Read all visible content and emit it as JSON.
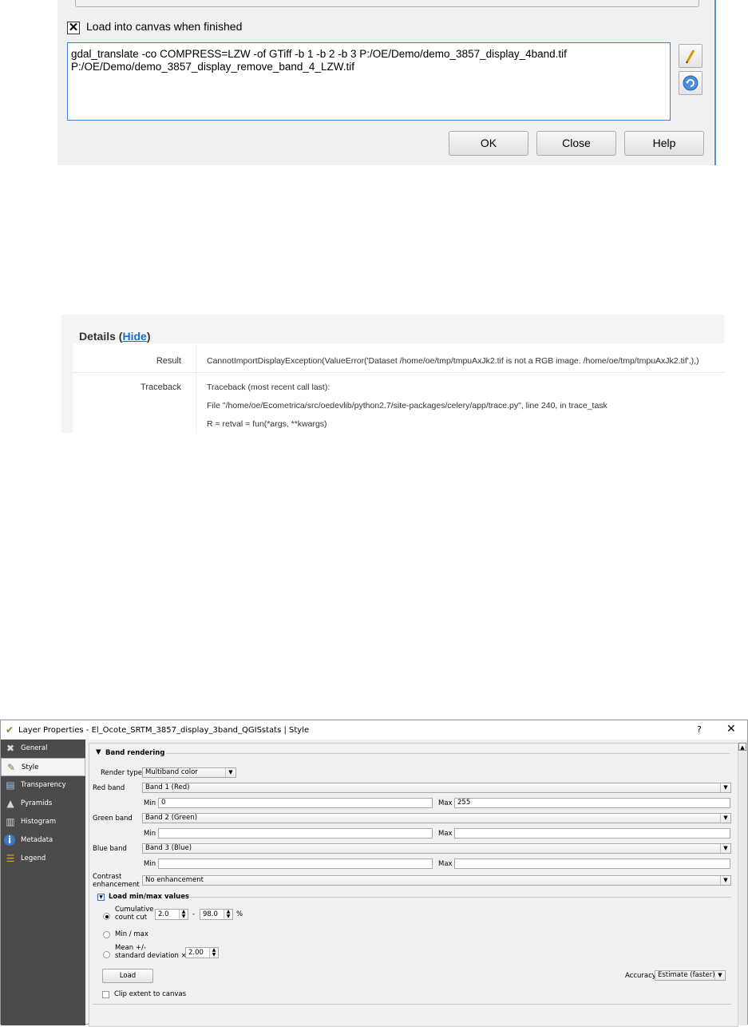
{
  "gdal_dialog": {
    "load_canvas_label": "Load into canvas when finished",
    "load_canvas_checked": true,
    "command_text": "gdal_translate -co COMPRESS=LZW -of GTiff -b 1 -b 2 -b 3 P:/OE/Demo/demo_3857_display_4band.tif\nP:/OE/Demo/demo_3857_display_remove_band_4_LZW.tif",
    "edit_icon": "pencil-icon",
    "reset_icon": "refresh-icon",
    "ok_label": "OK",
    "close_label": "Close",
    "help_label": "Help"
  },
  "details": {
    "title": "Details (",
    "hide_link": "Hide",
    "title_end": ")",
    "result_label": "Result",
    "result_value": "CannotImportDisplayException(ValueError('Dataset /home/oe/tmp/tmpuAxJk2.tif is not a RGB image. /home/oe/tmp/tmpuAxJk2.tif',),)",
    "traceback_label": "Traceback",
    "traceback_lines": [
      "Traceback (most recent call last):",
      "File \"/home/oe/Ecometrica/src/oedevlib/python2.7/site-packages/celery/app/trace.py\", line 240, in trace_task",
      "R = retval = fun(*args, **kwargs)"
    ]
  },
  "layer_props": {
    "title": "Layer Properties - El_Ocote_SRTM_3857_display_3band_QGISstats | Style",
    "help": "?",
    "close": "✕",
    "sidebar": [
      {
        "label": "General",
        "icon": "wrench-icon",
        "glyph": "✖"
      },
      {
        "label": "Style",
        "icon": "brush-icon",
        "glyph": "✎"
      },
      {
        "label": "Transparency",
        "icon": "transparency-icon",
        "glyph": "▤"
      },
      {
        "label": "Pyramids",
        "icon": "pyramids-icon",
        "glyph": "▲"
      },
      {
        "label": "Histogram",
        "icon": "histogram-icon",
        "glyph": "▥"
      },
      {
        "label": "Metadata",
        "icon": "info-icon",
        "glyph": "i"
      },
      {
        "label": "Legend",
        "icon": "legend-icon",
        "glyph": "☰"
      }
    ],
    "band_rendering": "Band rendering",
    "render_type_label": "Render type",
    "render_type_value": "Multiband color",
    "red_band_label": "Red band",
    "red_band_value": "Band 1 (Red)",
    "red_min": "0",
    "red_max": "255",
    "green_band_label": "Green band",
    "green_band_value": "Band 2 (Green)",
    "green_min": "",
    "green_max": "",
    "blue_band_label": "Blue band",
    "blue_band_value": "Band 3 (Blue)",
    "blue_min": "",
    "blue_max": "",
    "min_label": "Min",
    "max_label": "Max",
    "contrast_label_1": "Contrast",
    "contrast_label_2": "enhancement",
    "contrast_value": "No enhancement",
    "load_minmax": "Load min/max values",
    "cumulative_1": "Cumulative",
    "cumulative_2": "count cut",
    "cum_low": "2.0",
    "cum_dash": "-",
    "cum_high": "98.0",
    "cum_unit": "%",
    "minmax_label": "Min / max",
    "mean_1": "Mean +/-",
    "mean_2": "standard deviation ×",
    "mean_value": "2.00",
    "load_button": "Load",
    "accuracy_label": "Accuracy",
    "accuracy_value": "Estimate (faster)",
    "clip_label": "Clip extent to canvas"
  }
}
